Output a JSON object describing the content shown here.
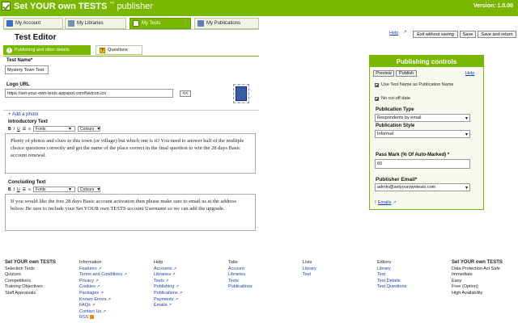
{
  "header": {
    "brand_prefix": "Set YOUR own TESTS",
    "brand_tm": "™",
    "brand_suffix": "publisher",
    "version": "Version: 1.0.00",
    "accent": "#7ab800"
  },
  "tabs": [
    {
      "label": "My Account",
      "icon": "account-icon"
    },
    {
      "label": "My Libraries",
      "icon": "libraries-icon"
    },
    {
      "label": "My Tests",
      "icon": "tests-icon",
      "active": true
    },
    {
      "label": "My Publications",
      "icon": "publications-icon"
    }
  ],
  "editor": {
    "title": "Test Editor",
    "help": "Help",
    "exit_btn": "Exit without saving",
    "save_btn": "Save",
    "save_return_btn": "Save and return",
    "subtabs": [
      "Publishing and other details",
      "Questions"
    ],
    "test_name_label": "Test Name*",
    "test_name_value": "Mystery Town Test",
    "logo_label": "Logo URL",
    "logo_value": "https://set-your-own-tests.appspot.com/favicon.ico",
    "logo_btn": "<<",
    "add_photo": "+ Add a photo",
    "intro_label": "Introductory Text",
    "intro_text": "Plenty of photos and clues to this town (or village) but which one is it? You need to answer half of the multiple choice questions correctly and get the name of the place correct in the final question to win the 28 days Basic account renewal.",
    "concl_label": "Concluding Text",
    "concl_text": "If you would like the free 28 days Basic account activation then please make sure to email us at the address below. Be sure to include your Set YOUR own TESTS account Username so we can add the upgrade.",
    "toolbar_b": "B",
    "toolbar_i": "I",
    "toolbar_u": "U",
    "fonts": "Fonts",
    "colours": "Colours"
  },
  "publishing": {
    "title": "Publishing controls",
    "preview": "Preview",
    "publish": "Publish",
    "help": "Help",
    "use_name": "Use Test Name as Publication Name",
    "use_name_checked": true,
    "no_cutoff": "No cut-off date",
    "no_cutoff_checked": true,
    "pub_type_label": "Publication Type",
    "pub_type_value": "Respondents by email",
    "pub_style_label": "Publication Style",
    "pub_style_value": "Informal",
    "pass_mark_label": "Pass Mark (% Of Auto-Marked) *",
    "pass_mark_value": "60",
    "publisher_email_label": "Publisher Email*",
    "publisher_email_value": "admin@setyourowntests.com",
    "emails_link": "Emails"
  },
  "footer": {
    "col1": [
      "Set YOUR own TESTS",
      "Selection Tests",
      "Quizzes",
      "Competitions",
      "Training Objectives",
      "Staff Appraisals"
    ],
    "col2": [
      "Information",
      "Features",
      "Terms and Conditions",
      "Privacy",
      "Cookies",
      "Packages",
      "Known Errors",
      "FAQs",
      "Contact Us",
      "RSS"
    ],
    "col3": [
      "Help",
      "Accounts",
      "Libraries",
      "Tests",
      "Publishing",
      "Publications",
      "Payments",
      "Emails"
    ],
    "col4": [
      "Tabs",
      "Account",
      "Libraries",
      "Tests",
      "Publications"
    ],
    "col5": [
      "Lists",
      "Library",
      "Test"
    ],
    "col6": [
      "Editors",
      "Library",
      "Test",
      "Test Details",
      "Test Questions"
    ],
    "col7": [
      "Set YOUR own TESTS",
      "Data Protection Act Safe",
      "Immediate",
      "Easy",
      "Free (Option)",
      "High Availability"
    ]
  }
}
